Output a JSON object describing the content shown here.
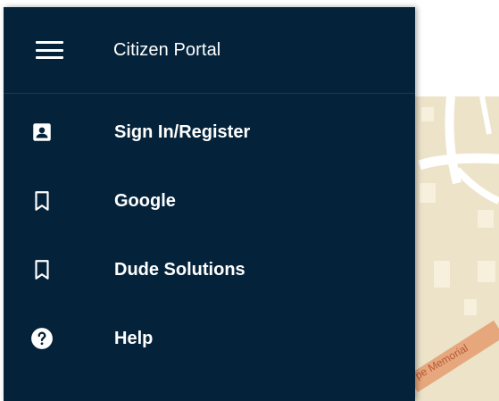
{
  "header": {
    "title": "Citizen Portal",
    "menu_icon": "hamburger-menu-icon"
  },
  "menu": {
    "items": [
      {
        "label": "Sign In/Register",
        "icon": "account-box-icon"
      },
      {
        "label": "Google",
        "icon": "bookmark-icon"
      },
      {
        "label": "Dude Solutions",
        "icon": "bookmark-icon"
      },
      {
        "label": "Help",
        "icon": "help-circle-icon"
      }
    ]
  },
  "map": {
    "street_label": "pe Memorial"
  },
  "colors": {
    "drawer_background": "#04233b",
    "text": "#ffffff",
    "map_background": "#ece3c9",
    "road_orange": "#e7a77c"
  }
}
